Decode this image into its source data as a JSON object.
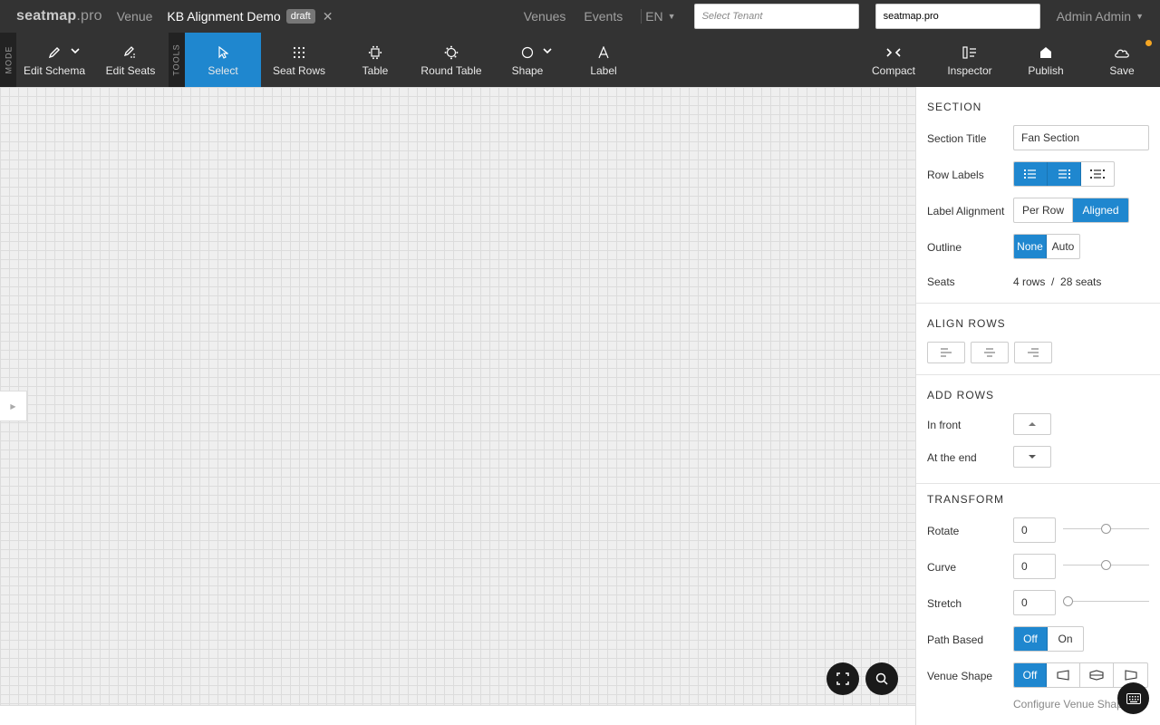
{
  "topbar": {
    "logo": "seatmap",
    "logo_suffix": ".pro",
    "breadcrumb_venue": "Venue",
    "schema_title": "KB Alignment Demo",
    "status_badge": "draft",
    "close_symbol": "✕",
    "nav_venues": "Venues",
    "nav_events": "Events",
    "language": "EN",
    "tenant_placeholder": "Select Tenant",
    "domain_value": "seatmap.pro",
    "user_name": "Admin Admin"
  },
  "toolbar": {
    "mode_label": "MODE",
    "tools_label": "TOOLS",
    "edit_schema": "Edit Schema",
    "edit_seats": "Edit Seats",
    "select": "Select",
    "seat_rows": "Seat Rows",
    "table": "Table",
    "round_table": "Round Table",
    "shape": "Shape",
    "label": "Label",
    "compact": "Compact",
    "inspector": "Inspector",
    "publish": "Publish",
    "save": "Save",
    "active_tool": "select",
    "accent_color": "#1f87cf",
    "unsaved_dot_color": "#f5a623"
  },
  "inspector": {
    "section": {
      "heading": "SECTION",
      "title_label": "Section Title",
      "title_value": "Fan Section",
      "row_labels_label": "Row Labels",
      "row_labels_options": [
        "left-labels-icon",
        "right-labels-icon",
        "both-labels-icon"
      ],
      "label_alignment_label": "Label Alignment",
      "label_alignment_options": [
        "Per Row",
        "Aligned"
      ],
      "label_alignment_selected": "Aligned",
      "outline_label": "Outline",
      "outline_options": [
        "None",
        "Auto"
      ],
      "outline_selected": "None",
      "seats_label": "Seats",
      "rows_count": "4 rows",
      "seats_separator": "/",
      "seats_count": "28 seats"
    },
    "align_rows": {
      "heading": "ALIGN ROWS",
      "options": [
        "align-left-icon",
        "align-center-icon",
        "align-right-icon"
      ]
    },
    "add_rows": {
      "heading": "ADD ROWS",
      "in_front_label": "In front",
      "at_end_label": "At the end"
    },
    "transform": {
      "heading": "TRANSFORM",
      "rotate_label": "Rotate",
      "rotate_value": "0",
      "rotate_slider_fraction": 0.5,
      "curve_label": "Curve",
      "curve_value": "0",
      "curve_slider_fraction": 0.5,
      "stretch_label": "Stretch",
      "stretch_value": "0",
      "stretch_slider_fraction": 0.0,
      "path_based_label": "Path Based",
      "path_based_options": [
        "Off",
        "On"
      ],
      "path_based_selected": "Off",
      "venue_shape_label": "Venue Shape",
      "venue_shape_off": "Off",
      "venue_shape_icons": [
        "stage-left-icon",
        "stage-center-icon",
        "stage-right-icon"
      ],
      "configure_link": "Configure Venue Shape"
    }
  }
}
